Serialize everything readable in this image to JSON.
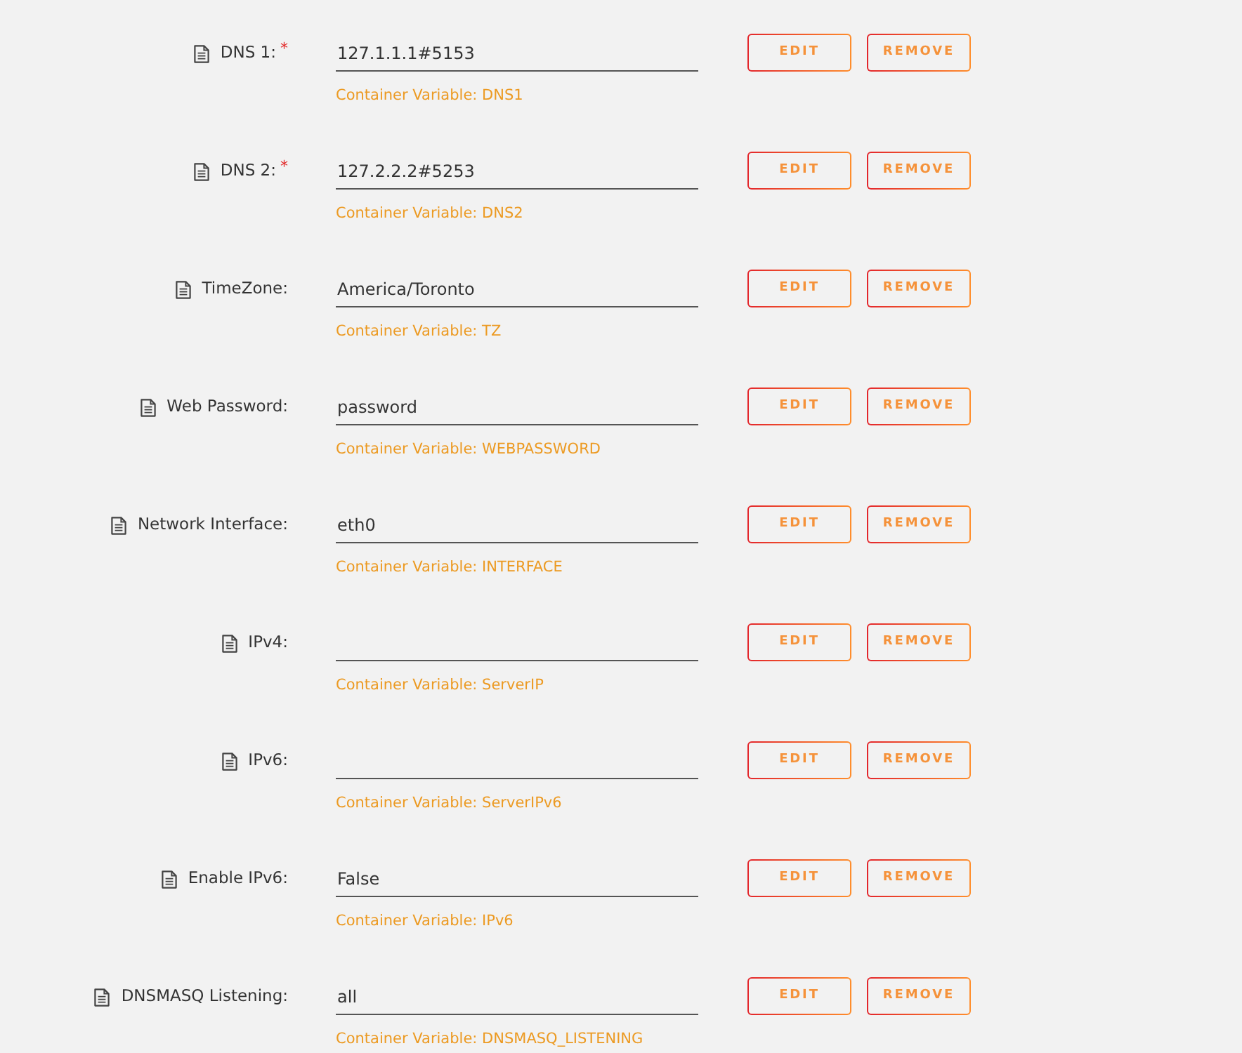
{
  "rows": [
    {
      "label": "DNS 1:",
      "required_mark": "*",
      "value": "127.1.1.1#5153",
      "variable": "Container Variable: DNS1",
      "edit": "EDIT",
      "remove": "REMOVE"
    },
    {
      "label": "DNS 2:",
      "required_mark": "*",
      "value": "127.2.2.2#5253",
      "variable": "Container Variable: DNS2",
      "edit": "EDIT",
      "remove": "REMOVE"
    },
    {
      "label": "TimeZone:",
      "value": "America/Toronto",
      "variable": "Container Variable: TZ",
      "edit": "EDIT",
      "remove": "REMOVE"
    },
    {
      "label": "Web Password:",
      "value": "password",
      "variable": "Container Variable: WEBPASSWORD",
      "edit": "EDIT",
      "remove": "REMOVE"
    },
    {
      "label": "Network Interface:",
      "value": "eth0",
      "variable": "Container Variable: INTERFACE",
      "edit": "EDIT",
      "remove": "REMOVE"
    },
    {
      "label": "IPv4:",
      "variable": "Container Variable: ServerIP",
      "edit": "EDIT",
      "remove": "REMOVE"
    },
    {
      "label": "IPv6:",
      "variable": "Container Variable: ServerIPv6",
      "edit": "EDIT",
      "remove": "REMOVE"
    },
    {
      "label": "Enable IPv6:",
      "value": "False",
      "variable": "Container Variable: IPv6",
      "edit": "EDIT",
      "remove": "REMOVE"
    },
    {
      "label": "DNSMASQ Listening:",
      "value": "all",
      "variable": "Container Variable: DNSMASQ_LISTENING",
      "edit": "EDIT",
      "remove": "REMOVE"
    }
  ]
}
